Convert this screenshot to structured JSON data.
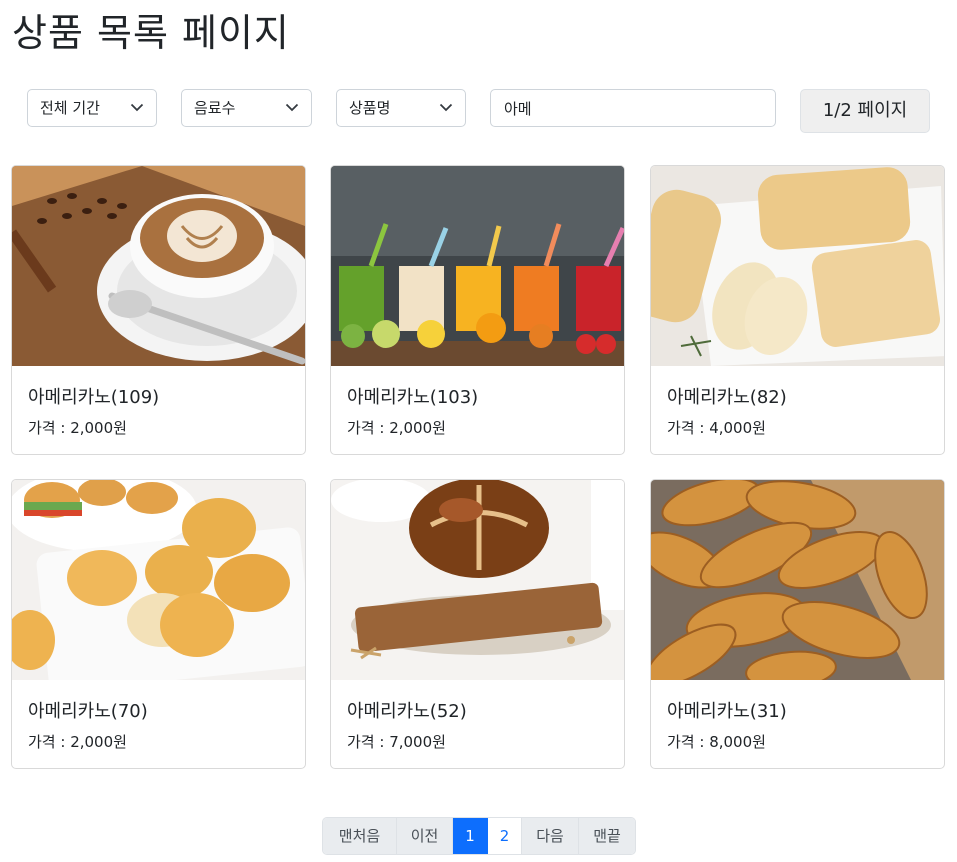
{
  "page": {
    "title": "상품 목록 페이지"
  },
  "filters": {
    "period": "전체 기간",
    "category": "음료수",
    "field": "상품명",
    "search_value": "아메",
    "page_indicator": "1/2 페이지"
  },
  "products": [
    {
      "name": "아메리카노(109)",
      "price": "가격 : 2,000원",
      "image": "latte"
    },
    {
      "name": "아메리카노(103)",
      "price": "가격 : 2,000원",
      "image": "juice"
    },
    {
      "name": "아메리카노(82)",
      "price": "가격 : 4,000원",
      "image": "ciabatta"
    },
    {
      "name": "아메리카노(70)",
      "price": "가격 : 2,000원",
      "image": "buns"
    },
    {
      "name": "아메리카노(52)",
      "price": "가격 : 7,000원",
      "image": "bread"
    },
    {
      "name": "아메리카노(31)",
      "price": "가격 : 8,000원",
      "image": "croissant"
    }
  ],
  "pagination": {
    "first": "맨처음",
    "prev": "이전",
    "pages": [
      "1",
      "2"
    ],
    "current": "1",
    "next": "다음",
    "last": "맨끝"
  },
  "colors": {
    "primary": "#0d6efd",
    "border": "#dee2e6",
    "button_bg": "#efefef"
  }
}
